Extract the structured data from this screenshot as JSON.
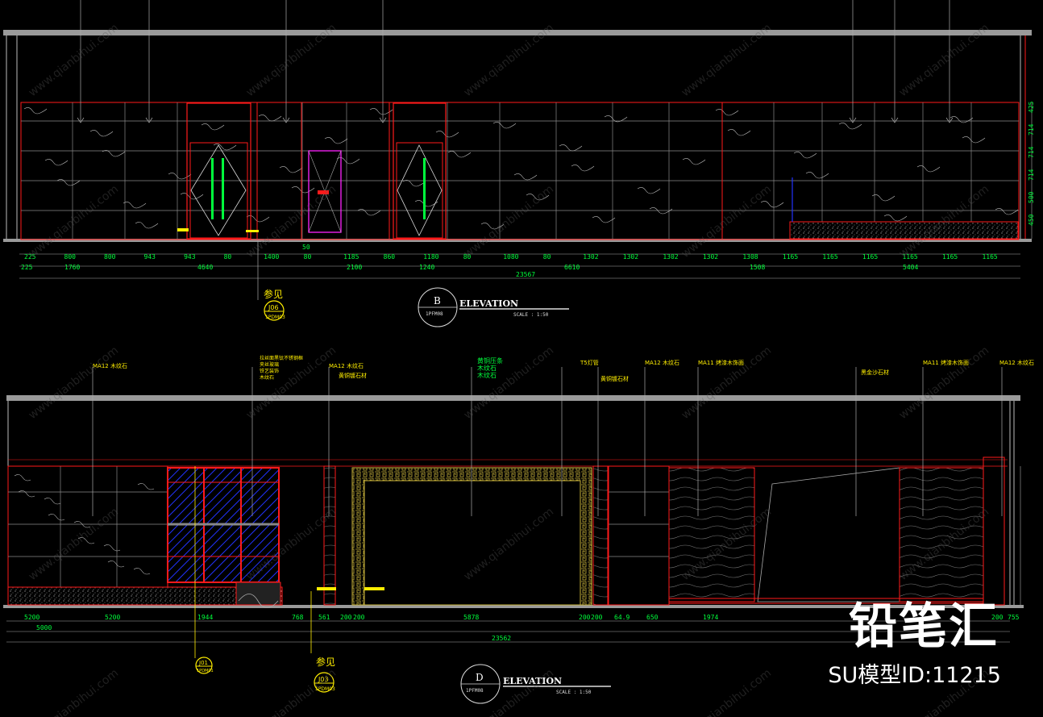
{
  "elevation_b": {
    "title": "ELEVATION",
    "marker": "B",
    "sheet": "1PFM08",
    "scale": "SCALE :   1:50",
    "dims_row1": [
      "225",
      "800",
      "800",
      "943",
      "943",
      "80",
      "1400",
      "80",
      "1185",
      "860",
      "1180",
      "80",
      "1080",
      "80",
      "1302",
      "1302",
      "1302",
      "1302",
      "1308",
      "1165",
      "1165",
      "1165",
      "1165",
      "1165",
      "1165"
    ],
    "dims_row2": [
      "225",
      "1760",
      "4640",
      "2100",
      "1240",
      "6610",
      "1508",
      "5404"
    ],
    "dim_total": "23567",
    "dim_small": "50",
    "door_width": "1400",
    "ref_label": "参见",
    "ref_code_top": "J06",
    "ref_code_bottom": "1PDM03",
    "right_dims": [
      "425",
      "714",
      "714",
      "714",
      "500",
      "450"
    ]
  },
  "elevation_d": {
    "title": "ELEVATION",
    "marker": "D",
    "sheet": "1PFM08",
    "scale": "SCALE :   1:50",
    "dims_row1": [
      "5200",
      "5200",
      "1944",
      "768",
      "561",
      "200",
      "200",
      "5878",
      "200",
      "200",
      "64.9",
      "650",
      "1974",
      "200",
      "755"
    ],
    "dims_row2": [
      "5000",
      "23562"
    ],
    "callouts": [
      "MA12 木纹石",
      "MA12 木纹石",
      "黄铜镀石材",
      "MA12 木纹石",
      "MA11 烤漆木饰面",
      "MA11 烤漆木饰面",
      "MA12 木纹石",
      "T5灯管",
      "黄铜镀石材",
      "黑金沙石材"
    ],
    "stack_notes": [
      "拉丝面黑钛不锈钢框",
      "夹丝玻璃",
      "铁艺装饰",
      "木纹石"
    ],
    "stack_notes2": [
      "黄铜压条",
      "木纹石",
      "木纹石"
    ],
    "ref_left_top": "J01",
    "ref_left_bottom": "1PDM01",
    "ref_label": "参见",
    "ref_right_top": "J03",
    "ref_right_bottom": "1PDM03"
  },
  "watermark": {
    "brand": "铅笔汇",
    "model_id": "SU模型ID:11215",
    "diag_text": "www.qianbihui.com"
  },
  "colors": {
    "bg": "#000000",
    "red": "#ff1a1a",
    "white": "#ffffff",
    "grey": "#9a9a9a",
    "green": "#00ff3c",
    "yellow": "#ffee00",
    "blue": "#2233ff",
    "magenta": "#ff22ff"
  }
}
